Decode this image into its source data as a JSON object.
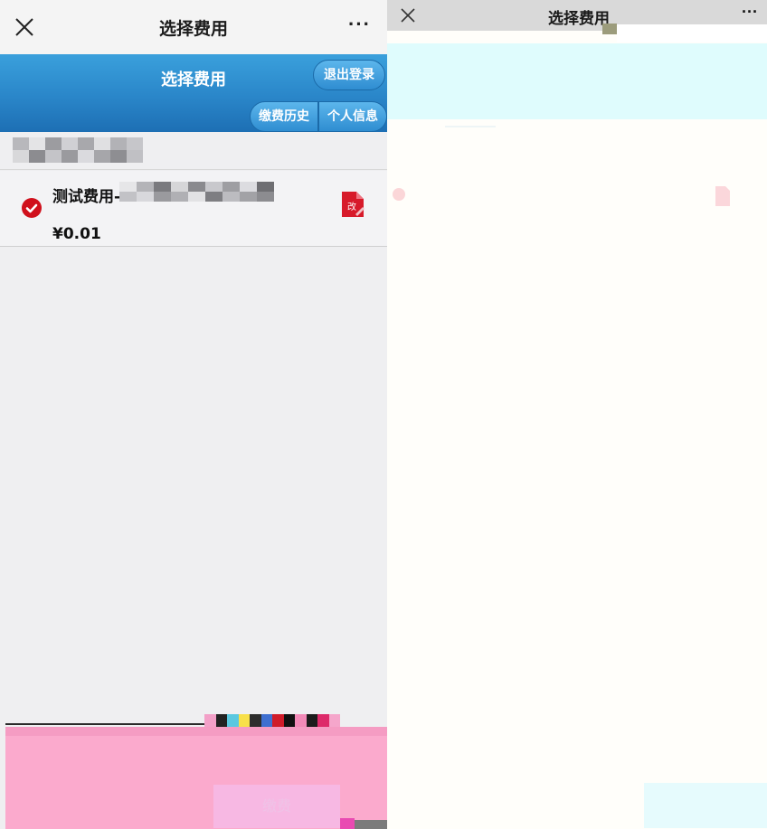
{
  "left": {
    "topbar": {
      "close_icon": "close-icon",
      "title": "选择费用",
      "more": "···"
    },
    "header": {
      "title": "选择费用",
      "logout": "退出登录",
      "history": "缴费历史",
      "profile": "个人信息"
    },
    "fee": {
      "name": "测试费用-",
      "price": "¥0.01",
      "selected": true,
      "edit_icon": "edit-document-icon"
    },
    "footer": {
      "submit": "缴费",
      "left_text": ""
    }
  },
  "right": {
    "topbar": {
      "title": "选择费用",
      "more": "···"
    }
  },
  "colors": {
    "header_blue": "#2a86c9",
    "check_red": "#d0101c",
    "footer_pink": "#fbaacd",
    "panel_bg": "#efeff1"
  }
}
